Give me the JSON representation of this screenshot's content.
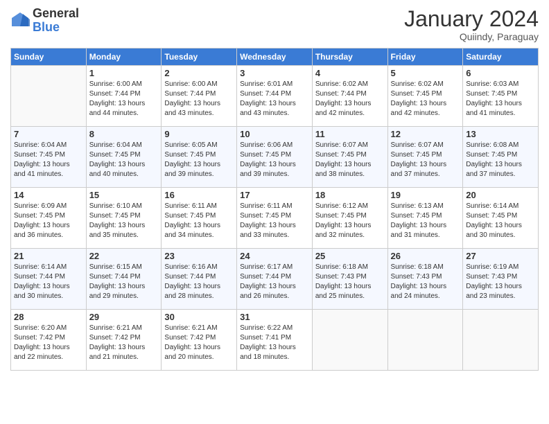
{
  "logo": {
    "general": "General",
    "blue": "Blue"
  },
  "header": {
    "month": "January 2024",
    "location": "Quiindy, Paraguay"
  },
  "weekdays": [
    "Sunday",
    "Monday",
    "Tuesday",
    "Wednesday",
    "Thursday",
    "Friday",
    "Saturday"
  ],
  "weeks": [
    [
      {
        "day": "",
        "sunrise": "",
        "sunset": "",
        "daylight": ""
      },
      {
        "day": "1",
        "sunrise": "Sunrise: 6:00 AM",
        "sunset": "Sunset: 7:44 PM",
        "daylight": "Daylight: 13 hours and 44 minutes."
      },
      {
        "day": "2",
        "sunrise": "Sunrise: 6:00 AM",
        "sunset": "Sunset: 7:44 PM",
        "daylight": "Daylight: 13 hours and 43 minutes."
      },
      {
        "day": "3",
        "sunrise": "Sunrise: 6:01 AM",
        "sunset": "Sunset: 7:44 PM",
        "daylight": "Daylight: 13 hours and 43 minutes."
      },
      {
        "day": "4",
        "sunrise": "Sunrise: 6:02 AM",
        "sunset": "Sunset: 7:44 PM",
        "daylight": "Daylight: 13 hours and 42 minutes."
      },
      {
        "day": "5",
        "sunrise": "Sunrise: 6:02 AM",
        "sunset": "Sunset: 7:45 PM",
        "daylight": "Daylight: 13 hours and 42 minutes."
      },
      {
        "day": "6",
        "sunrise": "Sunrise: 6:03 AM",
        "sunset": "Sunset: 7:45 PM",
        "daylight": "Daylight: 13 hours and 41 minutes."
      }
    ],
    [
      {
        "day": "7",
        "sunrise": "Sunrise: 6:04 AM",
        "sunset": "Sunset: 7:45 PM",
        "daylight": "Daylight: 13 hours and 41 minutes."
      },
      {
        "day": "8",
        "sunrise": "Sunrise: 6:04 AM",
        "sunset": "Sunset: 7:45 PM",
        "daylight": "Daylight: 13 hours and 40 minutes."
      },
      {
        "day": "9",
        "sunrise": "Sunrise: 6:05 AM",
        "sunset": "Sunset: 7:45 PM",
        "daylight": "Daylight: 13 hours and 39 minutes."
      },
      {
        "day": "10",
        "sunrise": "Sunrise: 6:06 AM",
        "sunset": "Sunset: 7:45 PM",
        "daylight": "Daylight: 13 hours and 39 minutes."
      },
      {
        "day": "11",
        "sunrise": "Sunrise: 6:07 AM",
        "sunset": "Sunset: 7:45 PM",
        "daylight": "Daylight: 13 hours and 38 minutes."
      },
      {
        "day": "12",
        "sunrise": "Sunrise: 6:07 AM",
        "sunset": "Sunset: 7:45 PM",
        "daylight": "Daylight: 13 hours and 37 minutes."
      },
      {
        "day": "13",
        "sunrise": "Sunrise: 6:08 AM",
        "sunset": "Sunset: 7:45 PM",
        "daylight": "Daylight: 13 hours and 37 minutes."
      }
    ],
    [
      {
        "day": "14",
        "sunrise": "Sunrise: 6:09 AM",
        "sunset": "Sunset: 7:45 PM",
        "daylight": "Daylight: 13 hours and 36 minutes."
      },
      {
        "day": "15",
        "sunrise": "Sunrise: 6:10 AM",
        "sunset": "Sunset: 7:45 PM",
        "daylight": "Daylight: 13 hours and 35 minutes."
      },
      {
        "day": "16",
        "sunrise": "Sunrise: 6:11 AM",
        "sunset": "Sunset: 7:45 PM",
        "daylight": "Daylight: 13 hours and 34 minutes."
      },
      {
        "day": "17",
        "sunrise": "Sunrise: 6:11 AM",
        "sunset": "Sunset: 7:45 PM",
        "daylight": "Daylight: 13 hours and 33 minutes."
      },
      {
        "day": "18",
        "sunrise": "Sunrise: 6:12 AM",
        "sunset": "Sunset: 7:45 PM",
        "daylight": "Daylight: 13 hours and 32 minutes."
      },
      {
        "day": "19",
        "sunrise": "Sunrise: 6:13 AM",
        "sunset": "Sunset: 7:45 PM",
        "daylight": "Daylight: 13 hours and 31 minutes."
      },
      {
        "day": "20",
        "sunrise": "Sunrise: 6:14 AM",
        "sunset": "Sunset: 7:45 PM",
        "daylight": "Daylight: 13 hours and 30 minutes."
      }
    ],
    [
      {
        "day": "21",
        "sunrise": "Sunrise: 6:14 AM",
        "sunset": "Sunset: 7:44 PM",
        "daylight": "Daylight: 13 hours and 30 minutes."
      },
      {
        "day": "22",
        "sunrise": "Sunrise: 6:15 AM",
        "sunset": "Sunset: 7:44 PM",
        "daylight": "Daylight: 13 hours and 29 minutes."
      },
      {
        "day": "23",
        "sunrise": "Sunrise: 6:16 AM",
        "sunset": "Sunset: 7:44 PM",
        "daylight": "Daylight: 13 hours and 28 minutes."
      },
      {
        "day": "24",
        "sunrise": "Sunrise: 6:17 AM",
        "sunset": "Sunset: 7:44 PM",
        "daylight": "Daylight: 13 hours and 26 minutes."
      },
      {
        "day": "25",
        "sunrise": "Sunrise: 6:18 AM",
        "sunset": "Sunset: 7:43 PM",
        "daylight": "Daylight: 13 hours and 25 minutes."
      },
      {
        "day": "26",
        "sunrise": "Sunrise: 6:18 AM",
        "sunset": "Sunset: 7:43 PM",
        "daylight": "Daylight: 13 hours and 24 minutes."
      },
      {
        "day": "27",
        "sunrise": "Sunrise: 6:19 AM",
        "sunset": "Sunset: 7:43 PM",
        "daylight": "Daylight: 13 hours and 23 minutes."
      }
    ],
    [
      {
        "day": "28",
        "sunrise": "Sunrise: 6:20 AM",
        "sunset": "Sunset: 7:42 PM",
        "daylight": "Daylight: 13 hours and 22 minutes."
      },
      {
        "day": "29",
        "sunrise": "Sunrise: 6:21 AM",
        "sunset": "Sunset: 7:42 PM",
        "daylight": "Daylight: 13 hours and 21 minutes."
      },
      {
        "day": "30",
        "sunrise": "Sunrise: 6:21 AM",
        "sunset": "Sunset: 7:42 PM",
        "daylight": "Daylight: 13 hours and 20 minutes."
      },
      {
        "day": "31",
        "sunrise": "Sunrise: 6:22 AM",
        "sunset": "Sunset: 7:41 PM",
        "daylight": "Daylight: 13 hours and 18 minutes."
      },
      {
        "day": "",
        "sunrise": "",
        "sunset": "",
        "daylight": ""
      },
      {
        "day": "",
        "sunrise": "",
        "sunset": "",
        "daylight": ""
      },
      {
        "day": "",
        "sunrise": "",
        "sunset": "",
        "daylight": ""
      }
    ]
  ]
}
